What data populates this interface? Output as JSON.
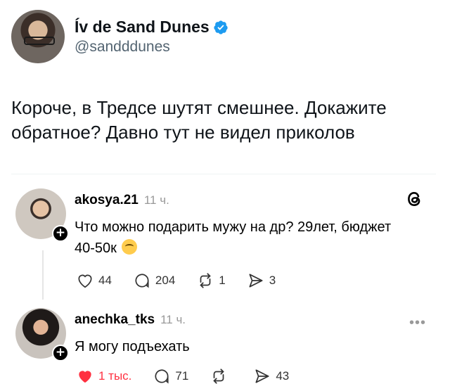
{
  "tweet": {
    "author_name": "Ív de Sand Dunes",
    "author_handle": "@sandddunes",
    "text": "Короче, в Тредсе шутят смешнее. Докажите обратное? Давно тут не видел приколов",
    "verified_icon": "verified-badge-icon",
    "accent_color": "#1d9bf0"
  },
  "threads": [
    {
      "username": "akosya.21",
      "time": "11 ч.",
      "text": "Что можно подарить мужу на др? 29лет, бюджет 40-50к",
      "likes": "44",
      "comments": "204",
      "reposts": "1",
      "shares": "3",
      "liked": false
    },
    {
      "username": "anechka_tks",
      "time": "11 ч.",
      "text": "Я могу подъехать",
      "likes": "1 тыс.",
      "comments": "71",
      "reposts": "",
      "shares": "43",
      "liked": true,
      "like_color": "#ff3040"
    }
  ]
}
